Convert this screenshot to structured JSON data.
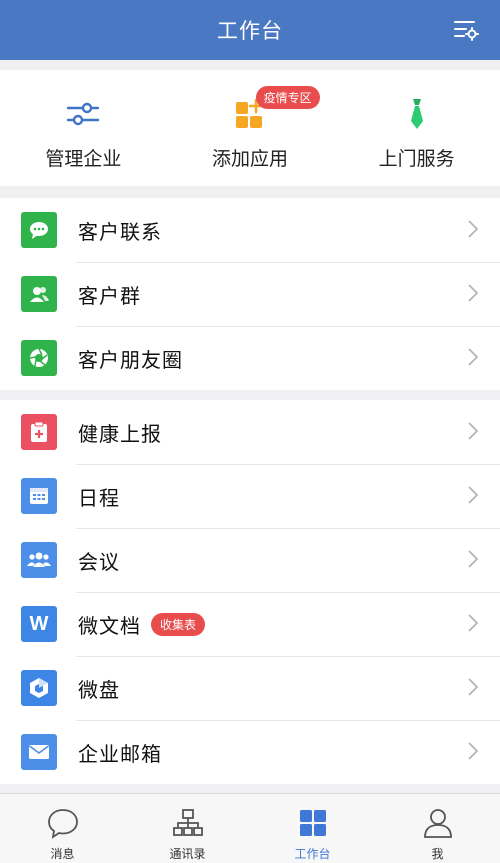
{
  "header": {
    "title": "工作台",
    "settings_icon": "settings-list-icon"
  },
  "quick_actions": [
    {
      "label": "管理企业",
      "icon": "sliders-icon"
    },
    {
      "label": "添加应用",
      "icon": "add-app-icon",
      "badge": "疫情专区"
    },
    {
      "label": "上门服务",
      "icon": "tie-icon"
    }
  ],
  "group1": [
    {
      "label": "客户联系",
      "icon": "chat-bubble-icon",
      "color": "#2fb34a"
    },
    {
      "label": "客户群",
      "icon": "customer-group-icon",
      "color": "#2fb34a"
    },
    {
      "label": "客户朋友圈",
      "icon": "aperture-icon",
      "color": "#2fb34a"
    }
  ],
  "group2": [
    {
      "label": "健康上报",
      "icon": "health-report-icon",
      "color": "#eb4f62"
    },
    {
      "label": "日程",
      "icon": "calendar-icon",
      "color": "#4c8ee8"
    },
    {
      "label": "会议",
      "icon": "meeting-icon",
      "color": "#4c8ee8"
    },
    {
      "label": "微文档",
      "icon": "word-doc-icon",
      "color": "#3d86e6",
      "tag": "收集表"
    },
    {
      "label": "微盘",
      "icon": "drive-icon",
      "color": "#3d86e6"
    },
    {
      "label": "企业邮箱",
      "icon": "mail-icon",
      "color": "#4c8ee8"
    }
  ],
  "tabs": [
    {
      "label": "消息",
      "icon": "message-icon",
      "active": false
    },
    {
      "label": "通讯录",
      "icon": "contacts-icon",
      "active": false
    },
    {
      "label": "工作台",
      "icon": "workbench-icon",
      "active": true
    },
    {
      "label": "我",
      "icon": "profile-icon",
      "active": false
    }
  ],
  "colors": {
    "header": "#4a78c2",
    "accent": "#3f78d6",
    "badge": "#e84c4c"
  }
}
